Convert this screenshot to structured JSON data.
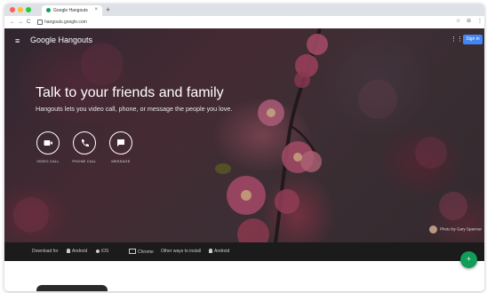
{
  "browser": {
    "tab_title": "Google Hangouts",
    "tab_close": "×",
    "new_tab": "+",
    "url": "hangouts.google.com",
    "nav": {
      "back": "←",
      "forward": "→",
      "reload": "C"
    },
    "right_icons": {
      "star": "☆",
      "account": "⊖",
      "menu": "⋮"
    }
  },
  "header": {
    "menu_icon": "≡",
    "brand": "Google Hangouts",
    "apps_icon": "⋮⋮⋮",
    "sign_in": "Sign in"
  },
  "hero": {
    "headline": "Talk to your friends and family",
    "subline": "Hangouts lets you video call, phone, or message the people you love.",
    "actions": [
      {
        "label": "VIDEO CALL",
        "icon": "video-camera-icon"
      },
      {
        "label": "PHONE CALL",
        "icon": "phone-icon"
      },
      {
        "label": "MESSAGE",
        "icon": "message-icon"
      }
    ],
    "photo_credit": "Photo by Gary Sparrow"
  },
  "footer": {
    "download_label": "Download for",
    "links": [
      {
        "label": "Android",
        "icon": "android-icon"
      },
      {
        "label": "iOS",
        "icon": "apple-icon"
      },
      {
        "label": "Chrome",
        "icon": "desktop-icon"
      },
      {
        "label": "Other ways to install",
        "icon": "none"
      },
      {
        "label": "Android",
        "icon": "android-icon"
      }
    ],
    "fab_icon": "+"
  },
  "colors": {
    "accent": "#4285f4",
    "fab": "#0f9d58",
    "footer_bg": "#1b1b1b",
    "close_dot": "#ff5f57",
    "minimize_dot": "#ffbd2e",
    "zoom_dot": "#28c940"
  }
}
